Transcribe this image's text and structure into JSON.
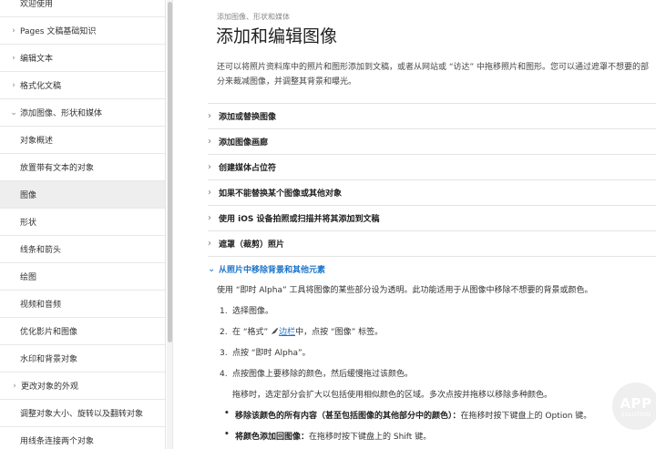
{
  "sidebar": {
    "items": [
      {
        "label": "欢迎使用",
        "level": "top",
        "chevron": false
      },
      {
        "label": "Pages 文稿基础知识",
        "level": "top",
        "chevron": true
      },
      {
        "label": "编辑文本",
        "level": "top",
        "chevron": true
      },
      {
        "label": "格式化文稿",
        "level": "top",
        "chevron": true
      },
      {
        "label": "添加图像、形状和媒体",
        "level": "top",
        "chevron": true,
        "expanded": true
      },
      {
        "label": "对象概述",
        "level": "sub"
      },
      {
        "label": "放置带有文本的对象",
        "level": "sub"
      },
      {
        "label": "图像",
        "level": "sub",
        "active": true
      },
      {
        "label": "形状",
        "level": "sub"
      },
      {
        "label": "线条和箭头",
        "level": "sub"
      },
      {
        "label": "绘图",
        "level": "sub"
      },
      {
        "label": "视频和音频",
        "level": "sub"
      },
      {
        "label": "优化影片和图像",
        "level": "sub"
      },
      {
        "label": "水印和背景对象",
        "level": "sub"
      },
      {
        "label": "更改对象的外观",
        "level": "sub",
        "chevron": true
      },
      {
        "label": "调整对象大小、旋转以及翻转对象",
        "level": "sub"
      },
      {
        "label": "用线条连接两个对象",
        "level": "sub"
      }
    ]
  },
  "main": {
    "breadcrumb": "添加图像、形状和媒体",
    "title": "添加和编辑图像",
    "intro": "还可以将照片资料库中的照片和图形添加到文稿，或者从网站或 “访达” 中拖移照片和图形。您可以通过遮罩不想要的部分来裁减图像，并调整其背景和曝光。",
    "sections": [
      {
        "label": "添加或替换图像"
      },
      {
        "label": "添加图像画廊"
      },
      {
        "label": "创建媒体占位符"
      },
      {
        "label": "如果不能替换某个图像或其他对象"
      },
      {
        "label": "使用 iOS 设备拍照或扫描并将其添加到文稿"
      },
      {
        "label": "遮罩（裁剪）照片"
      }
    ],
    "open_section": {
      "label": "从照片中移除背景和其他元素",
      "description": "使用 “即时 Alpha” 工具将图像的某些部分设为透明。此功能适用于从图像中移除不想要的背景或颜色。",
      "steps": [
        {
          "num": "1.",
          "text": "选择图像。"
        },
        {
          "num": "2.",
          "text_before": "在 “格式”",
          "link": "边栏",
          "text_after": "中，点按 “图像” 标签。"
        },
        {
          "num": "3.",
          "text": "点按 “即时 Alpha”。"
        },
        {
          "num": "4.",
          "text": "点按图像上要移除的颜色，然后缓慢拖过该颜色。"
        }
      ],
      "note": "拖移时，选定部分会扩大以包括使用相似颜色的区域。多次点按并拖移以移除多种颜色。",
      "bullets": [
        {
          "bold": "移除该颜色的所有内容（甚至包括图像的其他部分中的颜色）：",
          "text": "在拖移时按下键盘上的 Option 键。"
        },
        {
          "bold": "将颜色添加回图像：",
          "text": "在拖移时按下键盘上的 Shift 键。"
        }
      ]
    }
  },
  "watermark": {
    "line1": "APP",
    "line2": "SOLUTION"
  },
  "colors": {
    "accent": "#1a73c8",
    "active_bg": "#eeeeee"
  }
}
